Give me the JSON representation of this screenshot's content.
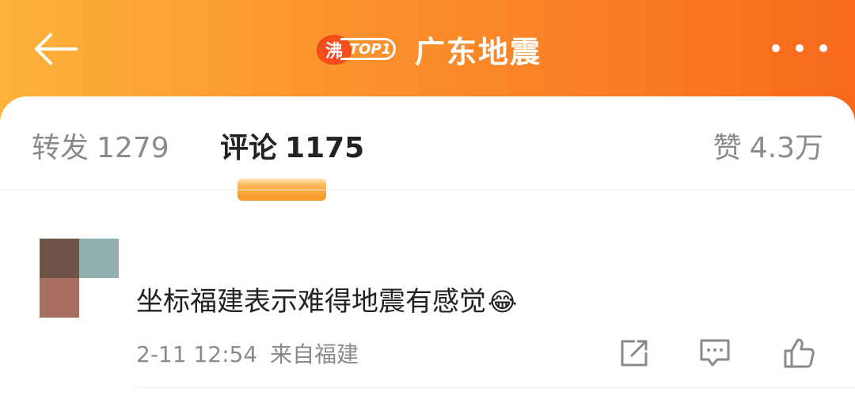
{
  "header": {
    "badge_icon_text": "沸",
    "badge_label": "TOP1",
    "title": "广东地震"
  },
  "tabs": {
    "repost": {
      "label": "转发",
      "count": "1279"
    },
    "comment": {
      "label": "评论",
      "count": "1175"
    },
    "like": {
      "label": "赞",
      "count": "4.3万"
    }
  },
  "comment": {
    "text": "坐标福建表示难得地震有感觉",
    "emoji": "😂",
    "time": "2-11 12:54",
    "source": "来自福建"
  },
  "icons": {
    "back": "arrow-left-icon",
    "more": "more-dots-icon",
    "share": "share-icon",
    "reply": "comment-icon",
    "like": "thumbs-up-icon"
  },
  "colors": {
    "header_start": "#fdb23a",
    "header_end": "#f86a1c",
    "tab_underline": "#f89521"
  }
}
